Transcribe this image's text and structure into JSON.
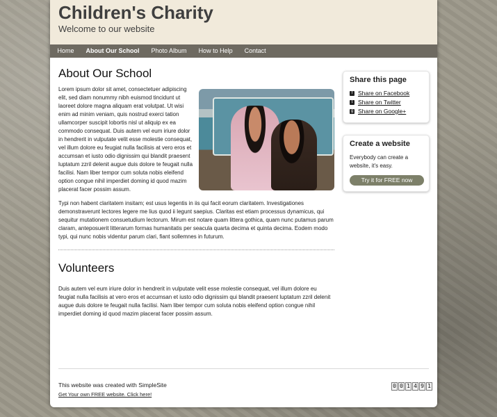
{
  "header": {
    "title": "Children's Charity",
    "subtitle": "Welcome to our website"
  },
  "nav": {
    "items": [
      {
        "label": "Home"
      },
      {
        "label": "About Our School"
      },
      {
        "label": "Photo Album"
      },
      {
        "label": "How to Help"
      },
      {
        "label": "Contact"
      }
    ],
    "active_index": 1
  },
  "main": {
    "heading": "About Our School",
    "paragraph1": "Lorem ipsum dolor sit amet, consectetuer adipiscing elit, sed diam nonummy nibh euismod tincidunt ut laoreet dolore magna aliquam erat volutpat. Ut wisi enim ad minim veniam, quis nostrud exerci tation ullamcorper suscipit lobortis nisl ut aliquip ex ea commodo consequat. Duis autem vel eum iriure dolor in hendrerit in vulputate velit esse molestie consequat, vel illum dolore eu feugiat nulla facilisis at vero eros et accumsan et iusto odio dignissim qui blandit praesent luptatum zzril delenit augue duis dolore te feugait nulla facilisi. Nam liber tempor cum soluta nobis eleifend option congue nihil imperdiet doming id quod mazim placerat facer possim assum.",
    "paragraph2": "Typi non habent claritatem insitam; est usus legentis in iis qui facit eorum claritatem. Investigationes demonstraverunt lectores legere me lius quod ii legunt saepius. Claritas est etiam processus dynamicus, qui sequitur mutationem consuetudium lectorum. Mirum est notare quam littera gothica, quam nunc putamus parum claram, anteposuerit litterarum formas humanitatis per seacula quarta decima et quinta decima. Eodem modo typi, qui nunc nobis videntur parum clari, fiant sollemnes in futurum.",
    "heading2": "Volunteers",
    "paragraph3": "Duis autem vel eum iriure dolor in hendrerit in vulputate velit esse molestie consequat, vel illum dolore eu feugiat nulla facilisis at vero eros et accumsan et iusto odio dignissim qui blandit praesent luptatum zzril delenit augue duis dolore te feugait nulla facilisi. Nam liber tempor cum soluta nobis eleifend option congue nihil imperdiet doming id quod mazim placerat facer possim assum."
  },
  "sidebar": {
    "share_title": "Share this page",
    "share_links": [
      {
        "label": "Share on Facebook",
        "icon": "facebook-icon",
        "glyph": "f"
      },
      {
        "label": "Share on Twitter",
        "icon": "twitter-icon",
        "glyph": "t"
      },
      {
        "label": "Share on Google+",
        "icon": "google-plus-icon",
        "glyph": "g"
      }
    ],
    "create_title": "Create a website",
    "create_text": "Everybody can create a website, it's easy.",
    "create_button": "Try it for FREE now"
  },
  "footer": {
    "text": "This website was created with SimpleSite",
    "link": "Get Your own FREE website. Click here!",
    "counter": [
      "0",
      "0",
      "1",
      "4",
      "9",
      "1"
    ]
  },
  "colors": {
    "header_bg": "#f1eadb",
    "nav_bg": "#6e6a61",
    "button_bg": "#7d8069"
  }
}
